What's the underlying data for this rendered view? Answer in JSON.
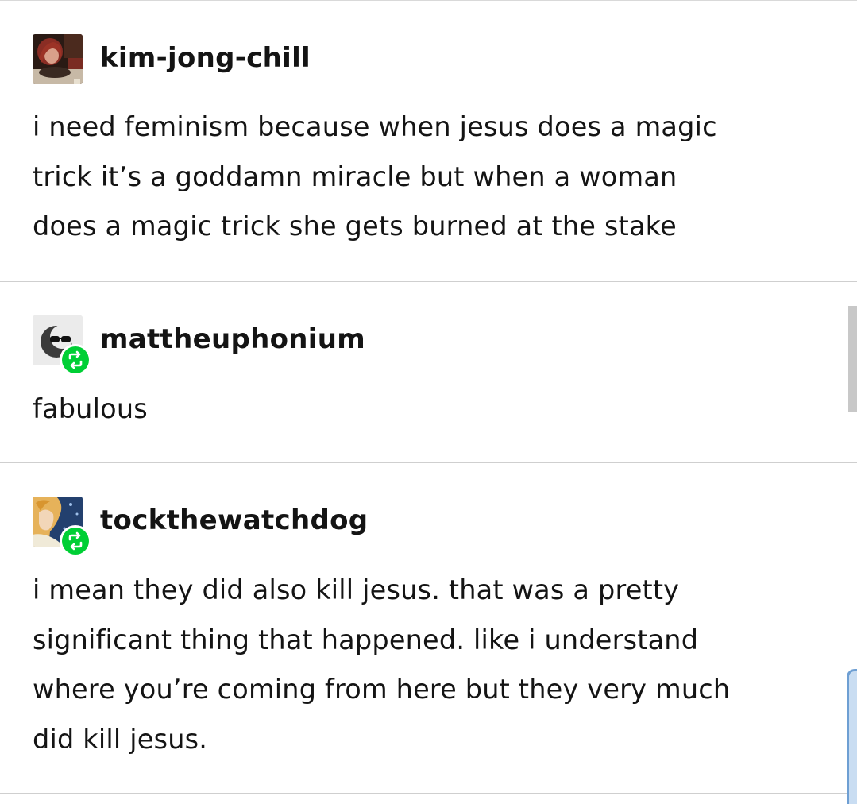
{
  "posts": [
    {
      "username": "kim-jong-chill",
      "avatar_icon": "profile-photo",
      "reblogged": false,
      "lines": [
        "i need feminism because when jesus does a magic",
        "trick it’s a goddamn miracle but when a woman",
        "does a magic trick she gets burned at the stake"
      ]
    },
    {
      "username": "mattheuphonium",
      "avatar_icon": "sunglasses-moon-avatar",
      "reblogged": true,
      "lines": [
        "fabulous"
      ]
    },
    {
      "username": "tockthewatchdog",
      "avatar_icon": "illustrated-portrait-avatar",
      "reblogged": true,
      "lines": [
        "i mean they did also kill jesus. that was a pretty",
        "significant thing that happened. like i understand",
        "where you’re coming from here but they very much",
        "did kill jesus."
      ]
    }
  ],
  "colors": {
    "text": "#141414",
    "divider": "#cfcfcf",
    "reblog_green": "#00cf35",
    "scrollbar": "#c8c8c8"
  }
}
